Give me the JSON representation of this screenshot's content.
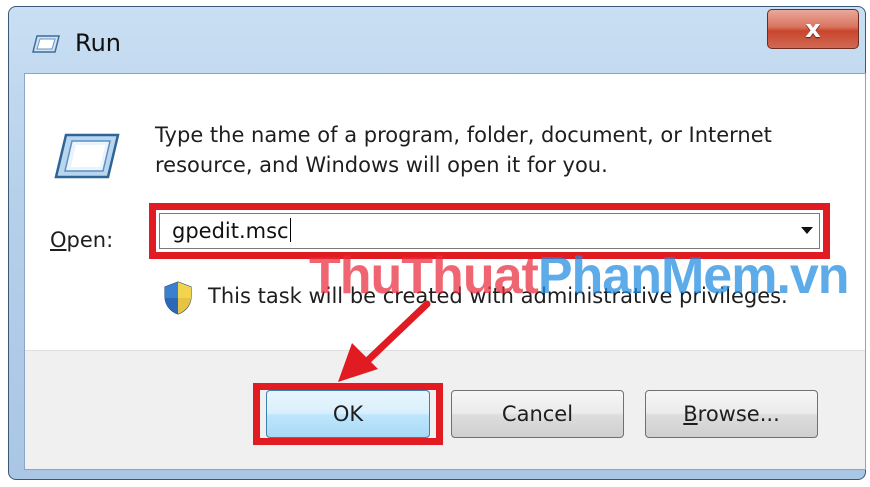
{
  "window": {
    "title": "Run",
    "close_glyph": "x"
  },
  "content": {
    "description": "Type the name of a program, folder, document, or Internet resource, and Windows will open it for you.",
    "open_label_first": "O",
    "open_label_rest": "pen:",
    "open_value": "gpedit.msc",
    "admin_note": "This task will be created with administrative privileges."
  },
  "watermark": {
    "part1": "ThuThuat",
    "part2": "PhanMem",
    "part3": ".vn"
  },
  "buttons": {
    "ok": "OK",
    "cancel": "Cancel",
    "browse_first": "B",
    "browse_rest": "rowse..."
  },
  "icons": {
    "window_icon": "run-icon",
    "shield": "uac-shield-icon",
    "dropdown": "chevron-down-icon"
  },
  "colors": {
    "highlight": "#e01b22",
    "watermark_red": "#ea2a3b",
    "watermark_blue": "#1f8be0",
    "close_button": "#c9452d"
  }
}
